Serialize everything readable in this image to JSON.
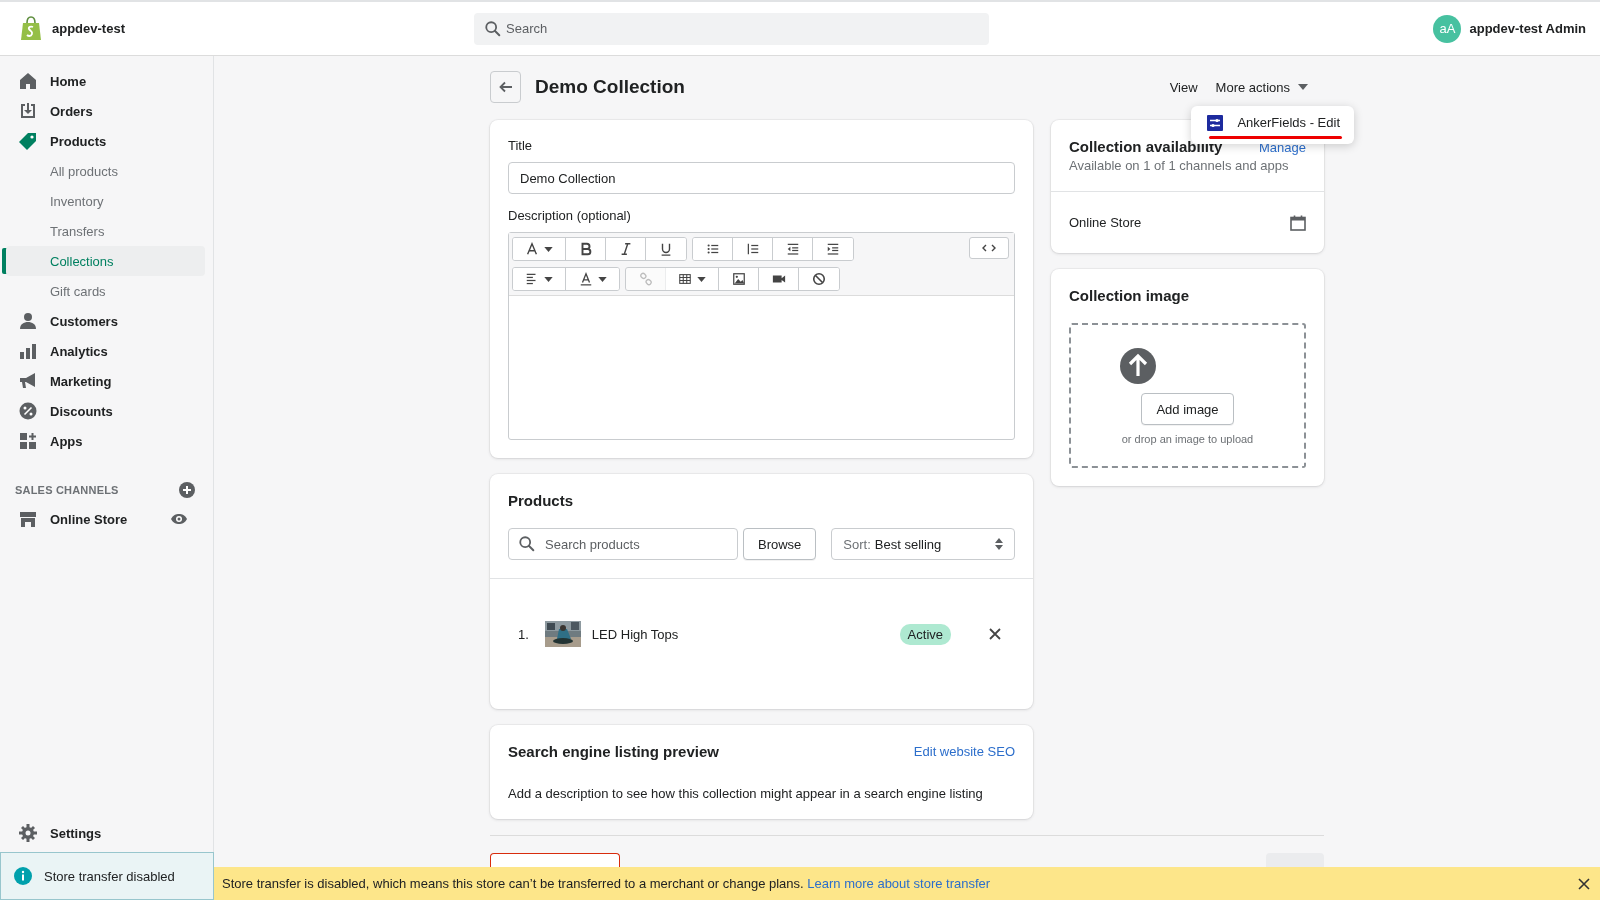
{
  "topbar": {
    "store_name": "appdev-test",
    "search": {
      "placeholder": "Search"
    },
    "avatar_initials": "aA",
    "user_name": "appdev-test Admin"
  },
  "sidebar": {
    "items": [
      {
        "label": "Home",
        "selected": false
      },
      {
        "label": "Orders",
        "selected": false
      },
      {
        "label": "Products",
        "selected": true,
        "children": [
          {
            "label": "All products",
            "selected": false
          },
          {
            "label": "Inventory",
            "selected": false
          },
          {
            "label": "Transfers",
            "selected": false
          },
          {
            "label": "Collections",
            "selected": true
          },
          {
            "label": "Gift cards",
            "selected": false
          }
        ]
      },
      {
        "label": "Customers",
        "selected": false
      },
      {
        "label": "Analytics",
        "selected": false
      },
      {
        "label": "Marketing",
        "selected": false
      },
      {
        "label": "Discounts",
        "selected": false
      },
      {
        "label": "Apps",
        "selected": false
      }
    ],
    "sales_channels": {
      "title": "SALES CHANNELS",
      "items": [
        {
          "label": "Online Store"
        }
      ]
    },
    "settings": "Settings",
    "notice": "Store transfer disabled"
  },
  "page": {
    "title": "Demo Collection",
    "actions": [
      {
        "label": "View",
        "kind": "link"
      },
      {
        "label": "More actions",
        "kind": "dropdown"
      }
    ],
    "menu": {
      "items": [
        {
          "label": "AnkerFields - Edit",
          "highlighted": true
        }
      ]
    }
  },
  "details": {
    "title_label": "Title",
    "title_value": "Demo Collection",
    "description_label": "Description (optional)",
    "toolbar": [
      [
        {
          "disabled": false
        },
        {
          "disabled": false
        },
        {
          "disabled": false
        },
        {
          "disabled": false
        }
      ],
      [
        {
          "disabled": false
        },
        {
          "disabled": false
        },
        {
          "disabled": false
        },
        {
          "disabled": false
        }
      ],
      [
        {
          "disabled": false
        },
        {
          "disabled": false
        }
      ],
      [
        {
          "disabled": true
        },
        {
          "disabled": false
        },
        {
          "disabled": false
        },
        {
          "disabled": false
        },
        {
          "disabled": false
        }
      ]
    ]
  },
  "products": {
    "title": "Products",
    "search": {
      "placeholder": "Search products"
    },
    "browse": "Browse",
    "sort_label": "Sort:",
    "sort_value": "Best selling",
    "rows": [
      {
        "number": "1.",
        "name": "LED High Tops",
        "status": "Active"
      }
    ]
  },
  "seo": {
    "title": "Search engine listing preview",
    "link": "Edit website SEO",
    "text": "Add a description to see how this collection might appear in a search engine listing"
  },
  "availability": {
    "title": "Collection availability",
    "link": "Manage",
    "summary": "Available on 1 of 1 channels and apps",
    "channels": [
      {
        "name": "Online Store"
      }
    ]
  },
  "image": {
    "title": "Collection image",
    "button": "Add image",
    "hint": "or drop an image to upload"
  },
  "banner": {
    "text": "Store transfer is disabled, which means this store can’t be transferred to a merchant or change plans.",
    "link": "Learn more about store transfer"
  }
}
